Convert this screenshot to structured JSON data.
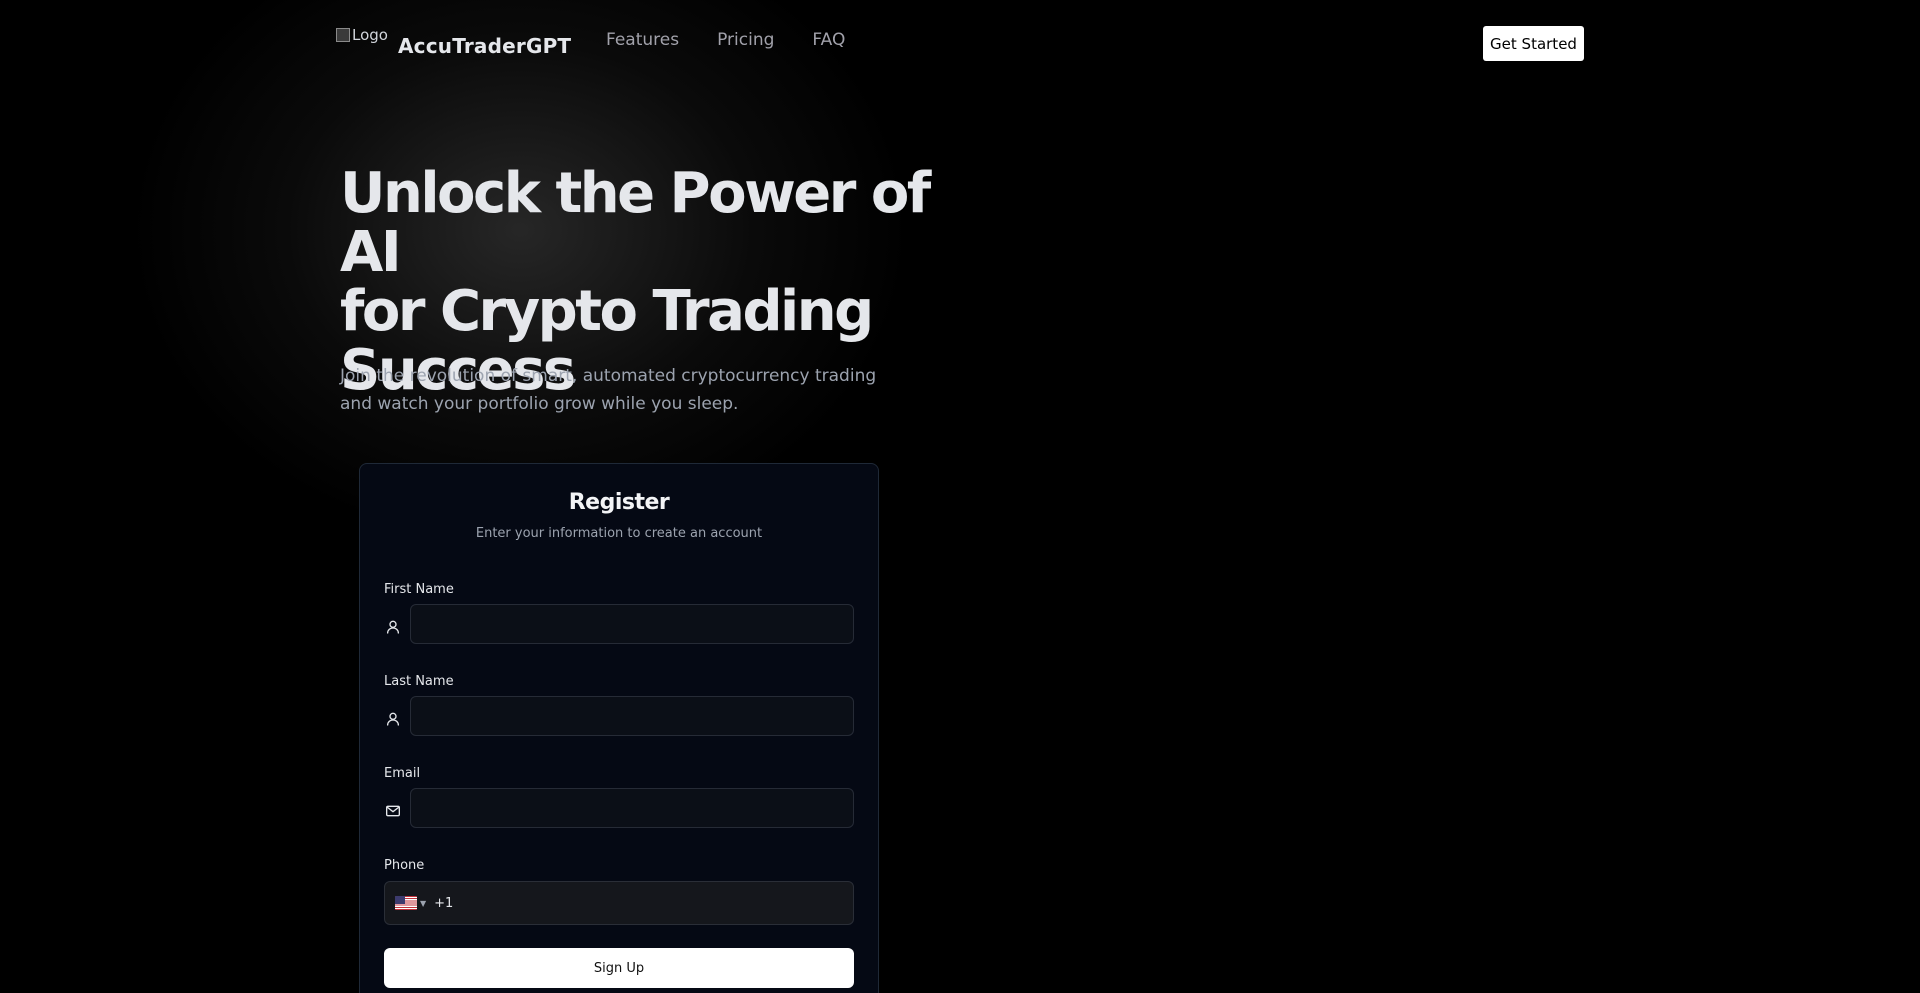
{
  "header": {
    "logo_alt": "Logo",
    "brand": "AccuTraderGPT",
    "nav": [
      {
        "label": "Features"
      },
      {
        "label": "Pricing"
      },
      {
        "label": "FAQ"
      }
    ],
    "cta_label": "Get Started"
  },
  "hero": {
    "title_lines": [
      "Unlock the Power of AI",
      "for Crypto Trading",
      "Success"
    ],
    "subtitle": "Join the revolution of smart, automated cryptocurrency trading and watch your portfolio grow while you sleep."
  },
  "register": {
    "title": "Register",
    "subtitle": "Enter your information to create an account",
    "fields": {
      "first_name": {
        "label": "First Name",
        "value": "",
        "icon": "user-icon"
      },
      "last_name": {
        "label": "Last Name",
        "value": "",
        "icon": "user-icon"
      },
      "email": {
        "label": "Email",
        "value": "",
        "icon": "mail-icon"
      },
      "phone": {
        "label": "Phone",
        "country": "US",
        "value": "+1"
      }
    },
    "submit_label": "Sign Up"
  },
  "colors": {
    "background": "#000000",
    "card_bg": "#050914",
    "button_bg": "#ffffff"
  }
}
